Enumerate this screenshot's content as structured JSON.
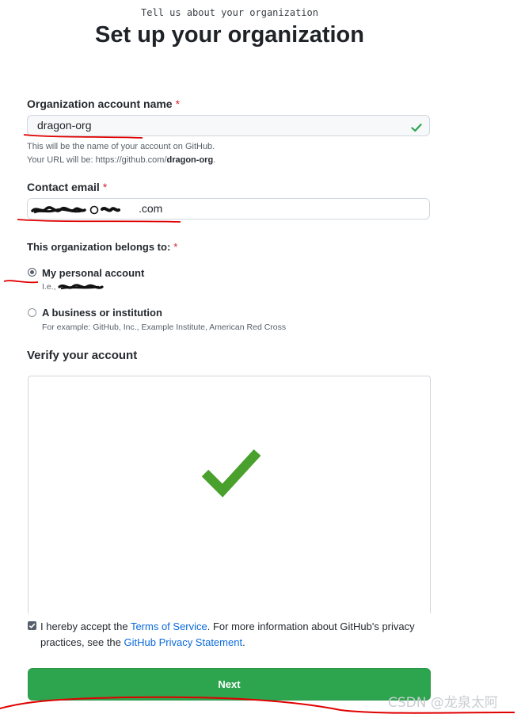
{
  "header": {
    "kicker": "Tell us about your organization",
    "title": "Set up your organization"
  },
  "org_name": {
    "label": "Organization account name",
    "required_mark": "*",
    "value": "dragon-org",
    "note_line1": "This will be the name of your account on GitHub.",
    "note_line2_prefix": "Your URL will be: https://github.com/",
    "note_line2_bold": "dragon-org",
    "note_line2_suffix": ".",
    "valid_icon": "check-icon"
  },
  "contact_email": {
    "label": "Contact email",
    "required_mark": "*",
    "value_suffix": ".com"
  },
  "belongs_to": {
    "label": "This organization belongs to:",
    "required_mark": "*",
    "options": [
      {
        "title": "My personal account",
        "subtitle": "I.e.,",
        "selected": true
      },
      {
        "title": "A business or institution",
        "subtitle": "For example: GitHub, Inc., Example Institute, American Red Cross",
        "selected": false
      }
    ]
  },
  "verify": {
    "heading": "Verify your account",
    "status_icon": "check-icon",
    "status_color": "#4aa02c"
  },
  "terms": {
    "checked": true,
    "text1": "I hereby accept the ",
    "link1": "Terms of Service",
    "text2": ". For more information about GitHub's privacy practices, see the ",
    "link2": "GitHub Privacy Statement",
    "text3": "."
  },
  "next_button": {
    "label": "Next",
    "color": "#2da44e"
  },
  "watermark": "CSDN @龙泉太阿",
  "colors": {
    "accent_link": "#0969da",
    "required": "#cf222e",
    "annotation": "#e00000"
  }
}
